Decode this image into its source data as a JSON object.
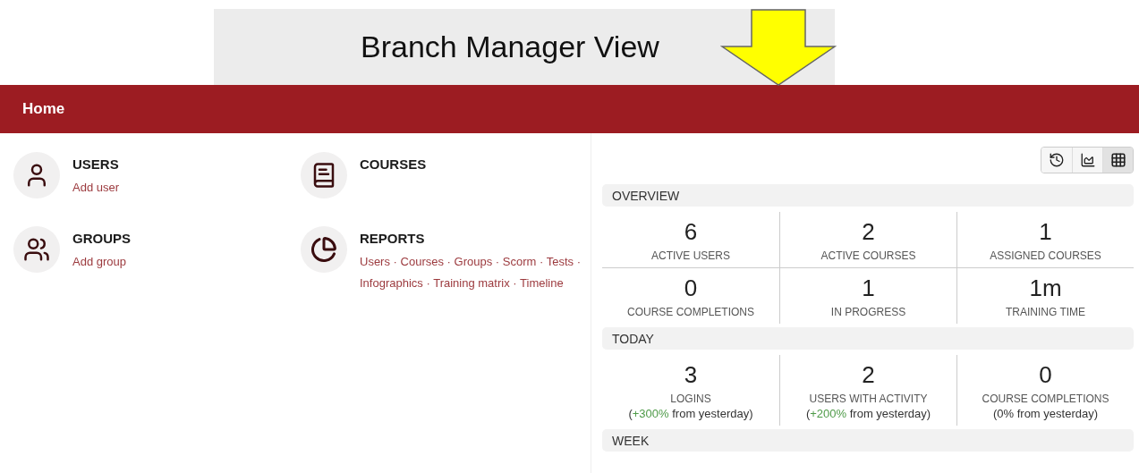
{
  "banner": {
    "title": "Branch Manager View"
  },
  "header": {
    "title": "Home"
  },
  "shortcuts": [
    {
      "kind": "users",
      "title": "USERS",
      "links": [
        "Add user"
      ]
    },
    {
      "kind": "courses",
      "title": "COURSES"
    },
    {
      "kind": "groups",
      "title": "GROUPS",
      "links": [
        "Add group"
      ]
    },
    {
      "kind": "reports",
      "title": "REPORTS",
      "links": [
        "Users",
        "Courses",
        "Groups",
        "Scorm",
        "Tests",
        "Infographics",
        "Training matrix",
        "Timeline"
      ]
    }
  ],
  "link_separator": "·",
  "view_toggle": [
    {
      "kind": "history",
      "selected": false
    },
    {
      "kind": "chart",
      "selected": false
    },
    {
      "kind": "grid",
      "selected": true
    }
  ],
  "sections": [
    {
      "title": "OVERVIEW",
      "stats": [
        {
          "value": "6",
          "label": "ACTIVE USERS"
        },
        {
          "value": "2",
          "label": "ACTIVE COURSES"
        },
        {
          "value": "1",
          "label": "ASSIGNED COURSES"
        },
        {
          "value": "0",
          "label": "COURSE COMPLETIONS"
        },
        {
          "value": "1",
          "label": "IN PROGRESS"
        },
        {
          "value": "1m",
          "label": "TRAINING TIME"
        }
      ]
    },
    {
      "title": "TODAY",
      "stats": [
        {
          "value": "3",
          "label": "LOGINS",
          "note": [
            {
              "text": "(",
              "kind": "plain"
            },
            {
              "text": "+300%",
              "kind": "positive"
            },
            {
              "text": " from yesterday)",
              "kind": "plain"
            }
          ]
        },
        {
          "value": "2",
          "label": "USERS WITH ACTIVITY",
          "note": [
            {
              "text": "(",
              "kind": "plain"
            },
            {
              "text": "+200%",
              "kind": "positive"
            },
            {
              "text": " from yesterday)",
              "kind": "plain"
            }
          ]
        },
        {
          "value": "0",
          "label": "COURSE COMPLETIONS",
          "note": [
            {
              "text": "(0% from yesterday)",
              "kind": "plain"
            }
          ]
        }
      ]
    },
    {
      "title": "WEEK"
    }
  ]
}
